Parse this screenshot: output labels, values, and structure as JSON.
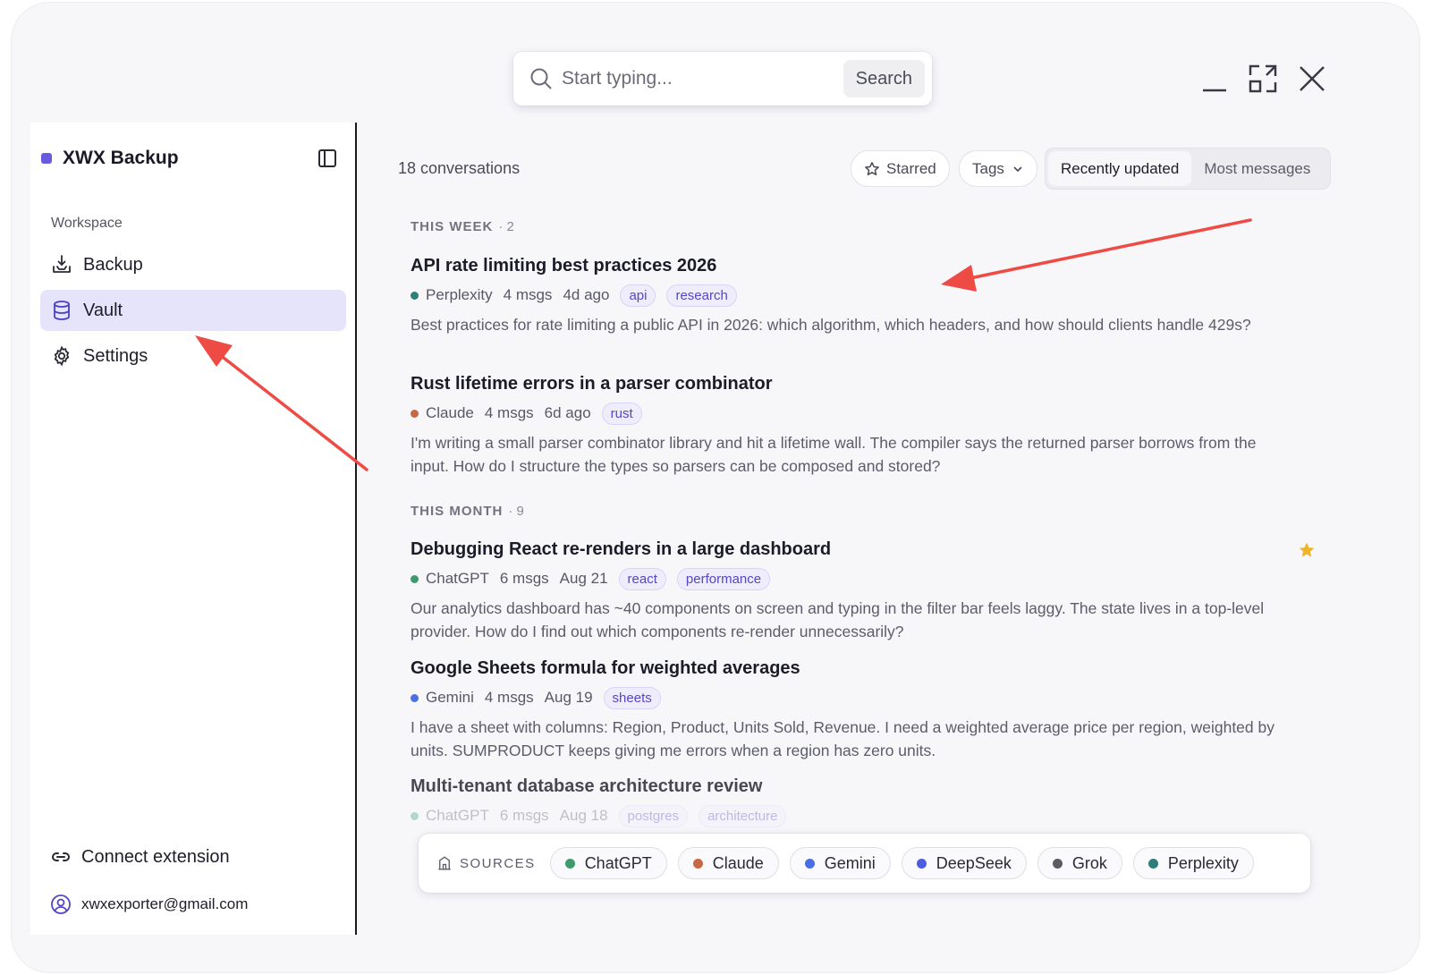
{
  "search": {
    "placeholder": "Start typing...",
    "button_label": "Search"
  },
  "sidebar": {
    "brand": "XWX Backup",
    "section_label": "Workspace",
    "items": [
      {
        "label": "Backup",
        "icon": "backup-icon"
      },
      {
        "label": "Vault",
        "icon": "database-icon",
        "active": true
      },
      {
        "label": "Settings",
        "icon": "gear-icon"
      }
    ],
    "bottom": {
      "connect_label": "Connect extension",
      "email": "xwxexporter@gmail.com"
    }
  },
  "main": {
    "count_label": "18 conversations",
    "filters": {
      "starred": "Starred",
      "tags": "Tags"
    },
    "sort": {
      "recent": "Recently updated",
      "most": "Most messages"
    },
    "groups": [
      {
        "title": "THIS WEEK",
        "count": "· 2"
      },
      {
        "title": "THIS MONTH",
        "count": "· 9"
      }
    ],
    "conversations": [
      {
        "title": "API rate limiting best practices 2026",
        "source": "Perplexity",
        "msgs": "4 msgs",
        "date": "4d ago",
        "tags": [
          "api",
          "research"
        ],
        "snippet": "Best practices for rate limiting a public API in 2026: which algorithm, which headers, and how should clients handle 429s?"
      },
      {
        "title": "Rust lifetime errors in a parser combinator",
        "source": "Claude",
        "msgs": "4 msgs",
        "date": "6d ago",
        "tags": [
          "rust"
        ],
        "snippet": "I'm writing a small parser combinator library and hit a lifetime wall. The compiler says the returned parser borrows from the input. How do I structure the types so parsers can be composed and stored?"
      },
      {
        "title": "Debugging React re-renders in a large dashboard",
        "source": "ChatGPT",
        "msgs": "6 msgs",
        "date": "Aug 21",
        "tags": [
          "react",
          "performance"
        ],
        "starred": true,
        "snippet": "Our analytics dashboard has ~40 components on screen and typing in the filter bar feels laggy. The state lives in a top-level provider. How do I find out which components re-render unnecessarily?"
      },
      {
        "title": "Google Sheets formula for weighted averages",
        "source": "Gemini",
        "msgs": "4 msgs",
        "date": "Aug 19",
        "tags": [
          "sheets"
        ],
        "snippet": "I have a sheet with columns: Region, Product, Units Sold, Revenue. I need a weighted average price per region, weighted by units. SUMPRODUCT keeps giving me errors when a region has zero units."
      },
      {
        "title": "Multi-tenant database architecture review",
        "source": "ChatGPT",
        "msgs": "6 msgs",
        "date": "Aug 18",
        "tags": [
          "postgres",
          "architecture"
        ]
      }
    ]
  },
  "sources_bar": {
    "label": "SOURCES",
    "items": [
      "ChatGPT",
      "Claude",
      "Gemini",
      "DeepSeek",
      "Grok",
      "Perplexity"
    ]
  },
  "colors": {
    "accent": "#6759e0",
    "chatgpt": "#3f9a6e",
    "claude": "#c56a45",
    "gemini": "#4a6fe3",
    "deepseek": "#4e5ce0",
    "grok": "#5b5d63",
    "perplexity": "#2f7f78",
    "star": "#f0b429",
    "annotation_arrow": "#ee4b45"
  }
}
